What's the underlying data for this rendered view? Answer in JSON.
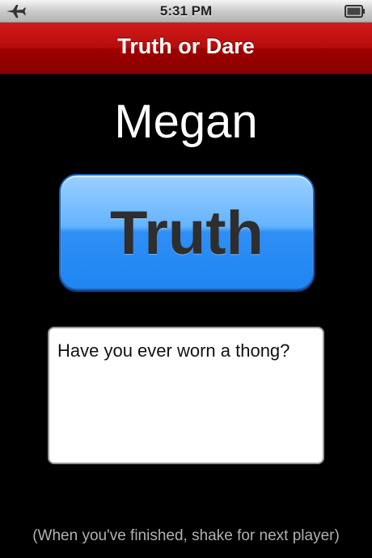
{
  "status_bar": {
    "time": "5:31 PM",
    "mode_icon": "airplane-icon",
    "battery_icon": "battery-icon"
  },
  "nav_bar": {
    "title": "Truth or Dare"
  },
  "player": {
    "name": "Megan"
  },
  "choice_button": {
    "label": "Truth"
  },
  "question": {
    "text": "Have you ever worn a thong?"
  },
  "footer": {
    "hint": "(When you've finished, shake for next player)"
  },
  "colors": {
    "nav_red": "#b70d0d",
    "button_blue": "#2f8ff5",
    "background": "#000000"
  }
}
